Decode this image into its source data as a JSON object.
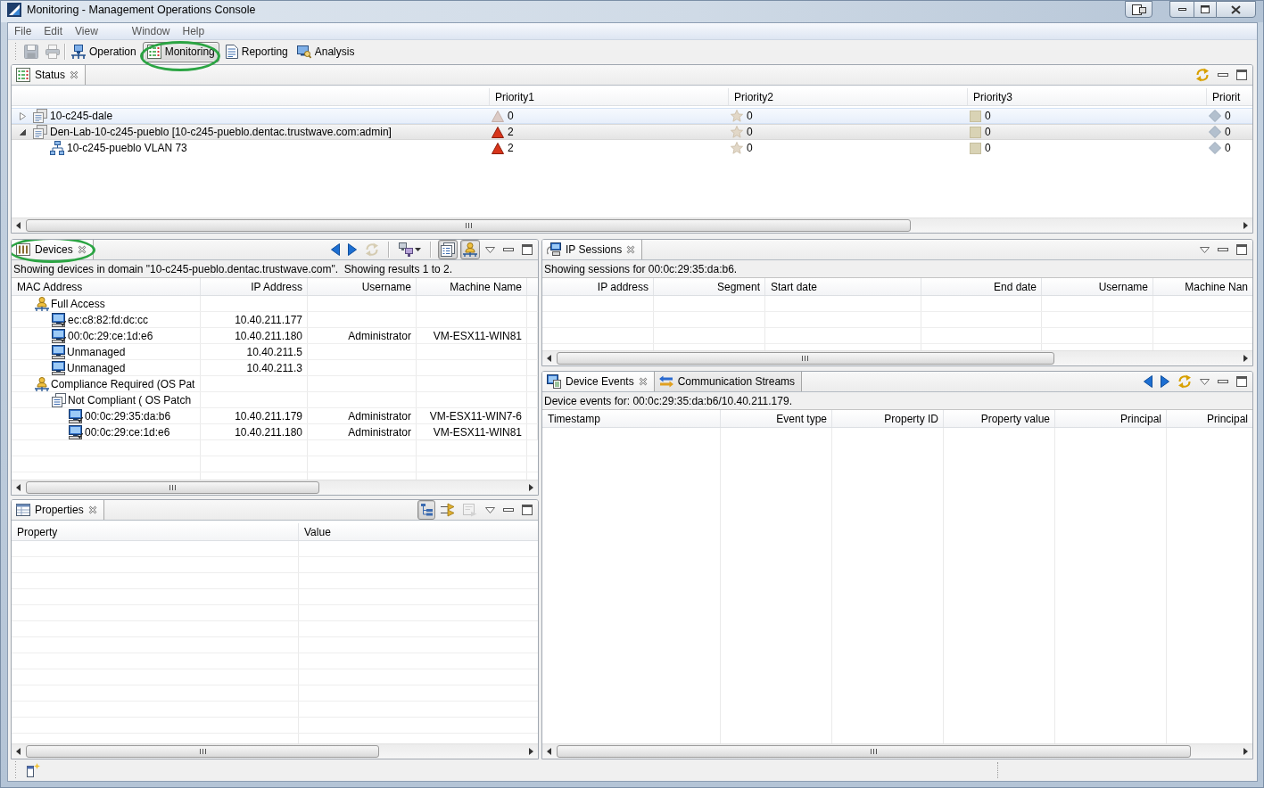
{
  "window": {
    "title": "Monitoring - Management Operations Console"
  },
  "menu": [
    "File",
    "Edit",
    "View",
    "Window",
    "Help"
  ],
  "toolbar": {
    "actions": [
      {
        "kind": "save",
        "disabled": true
      },
      {
        "kind": "print",
        "disabled": true
      }
    ],
    "perspectives": [
      {
        "label": "Operation",
        "kind": "operations",
        "selected": false,
        "highlighted": false
      },
      {
        "label": "Monitoring",
        "kind": "monitoring",
        "selected": true,
        "highlighted": true
      },
      {
        "label": "Reporting",
        "kind": "reporting",
        "selected": false,
        "highlighted": false
      },
      {
        "label": "Analysis",
        "kind": "analysis",
        "selected": false,
        "highlighted": false
      }
    ]
  },
  "status_view": {
    "tab": {
      "label": "Status",
      "selected": true,
      "highlighted": false
    },
    "tool_groups": [
      [
        {
          "kind": "refresh",
          "disabled": false
        }
      ]
    ],
    "columns": [
      {
        "label": "Priority1",
        "kind": "triangle"
      },
      {
        "label": "Priority2",
        "kind": "star"
      },
      {
        "label": "Priority3",
        "kind": "square"
      },
      {
        "label": "Priorit",
        "kind": "diamond"
      }
    ],
    "rows": [
      {
        "name": "10-c245-dale",
        "kind": "domain",
        "expanded": false,
        "selected": false,
        "hovered": true,
        "counts": [
          {
            "value": "0",
            "active": false
          },
          {
            "value": "0",
            "active": false
          },
          {
            "value": "0",
            "active": false
          },
          {
            "value": "0",
            "active": false
          }
        ]
      },
      {
        "name": "Den-Lab-10-c245-pueblo [10-c245-pueblo.dentac.trustwave.com:admin]",
        "kind": "domain",
        "expanded": true,
        "selected": true,
        "hovered": false,
        "counts": [
          {
            "value": "2",
            "active": true
          },
          {
            "value": "0",
            "active": false
          },
          {
            "value": "0",
            "active": false
          },
          {
            "value": "0",
            "active": false
          }
        ],
        "children": [
          {
            "name": "10-c245-pueblo VLAN 73",
            "kind": "vlan",
            "selected": false,
            "hovered": false,
            "counts": [
              {
                "value": "2",
                "active": true
              },
              {
                "value": "0",
                "active": false
              },
              {
                "value": "0",
                "active": false
              },
              {
                "value": "0",
                "active": false
              }
            ]
          }
        ]
      }
    ]
  },
  "devices_view": {
    "tab": {
      "label": "Devices",
      "selected": true,
      "highlighted": true
    },
    "tool_groups": [
      [
        {
          "kind": "back",
          "disabled": false
        },
        {
          "kind": "forward",
          "disabled": false
        },
        {
          "kind": "refresh",
          "disabled": true
        }
      ],
      [
        {
          "kind": "filter",
          "disabled": false
        }
      ],
      [
        {
          "kind": "tree",
          "disabled": false,
          "on": true
        },
        {
          "kind": "group",
          "disabled": false,
          "on": true
        }
      ]
    ],
    "info": "Showing devices in domain \"10-c245-pueblo.dentac.trustwave.com\".  Showing results 1 to 2.",
    "columns": [
      "MAC Address",
      "IP Address",
      "Username",
      "Machine Name"
    ],
    "rows": [
      {
        "kind": "policy",
        "name": "Full Access",
        "selected": false,
        "children": [
          {
            "kind": "managed",
            "name": "ec:c8:82:fd:dc:cc",
            "ip_address": "10.40.211.177",
            "selected": false
          },
          {
            "kind": "managed",
            "name": "00:0c:29:ce:1d:e6",
            "ip_address": "10.40.211.180",
            "username": "Administrator",
            "machine_name": "VM-ESX11-WIN81",
            "selected": false
          },
          {
            "kind": "unmanaged",
            "name": "Unmanaged",
            "ip_address": "10.40.211.5",
            "selected": false
          },
          {
            "kind": "unmanaged",
            "name": "Unmanaged",
            "ip_address": "10.40.211.3",
            "selected": false
          }
        ]
      },
      {
        "kind": "policy",
        "name": "Compliance Required (OS Pat",
        "selected": false,
        "children": [
          {
            "kind": "rule",
            "name": "Not Compliant ( OS Patch",
            "selected": false,
            "children": [
              {
                "kind": "managed",
                "name": "00:0c:29:35:da:b6",
                "ip_address": "10.40.211.179",
                "username": "Administrator",
                "machine_name": "VM-ESX11-WIN7-6",
                "selected": false
              },
              {
                "kind": "managed",
                "name": "00:0c:29:ce:1d:e6",
                "ip_address": "10.40.211.180",
                "username": "Administrator",
                "machine_name": "VM-ESX11-WIN81",
                "selected": false
              }
            ]
          }
        ]
      }
    ]
  },
  "properties_view": {
    "tab": {
      "label": "Properties",
      "selected": true,
      "highlighted": false
    },
    "tool_groups": [
      [
        {
          "kind": "categories",
          "disabled": false,
          "on": true
        },
        {
          "kind": "advanced",
          "disabled": false,
          "on": false
        },
        {
          "kind": "defaults",
          "disabled": true
        }
      ]
    ],
    "columns": [
      "Property",
      "Value"
    ]
  },
  "ip_sessions_view": {
    "tab": {
      "label": "IP Sessions",
      "selected": true,
      "highlighted": false
    },
    "info": "Showing sessions for 00:0c:29:35:da:b6.",
    "columns": [
      "IP address",
      "Segment",
      "Start date",
      "End date",
      "Username",
      "Machine Nan"
    ]
  },
  "events_view": {
    "tabs": [
      {
        "label": "Device Events",
        "kind": "events",
        "selected": true,
        "highlighted": false
      },
      {
        "label": "Communication Streams",
        "kind": "streams",
        "selected": false,
        "highlighted": false
      }
    ],
    "tool_groups": [
      [
        {
          "kind": "back",
          "disabled": false
        },
        {
          "kind": "forward",
          "disabled": false
        },
        {
          "kind": "refresh",
          "disabled": false
        }
      ]
    ],
    "info": "Device events for: 00:0c:29:35:da:b6/10.40.211.179.",
    "columns": [
      "Timestamp",
      "Event type",
      "Property ID",
      "Property value",
      "Principal",
      "Principal"
    ]
  }
}
